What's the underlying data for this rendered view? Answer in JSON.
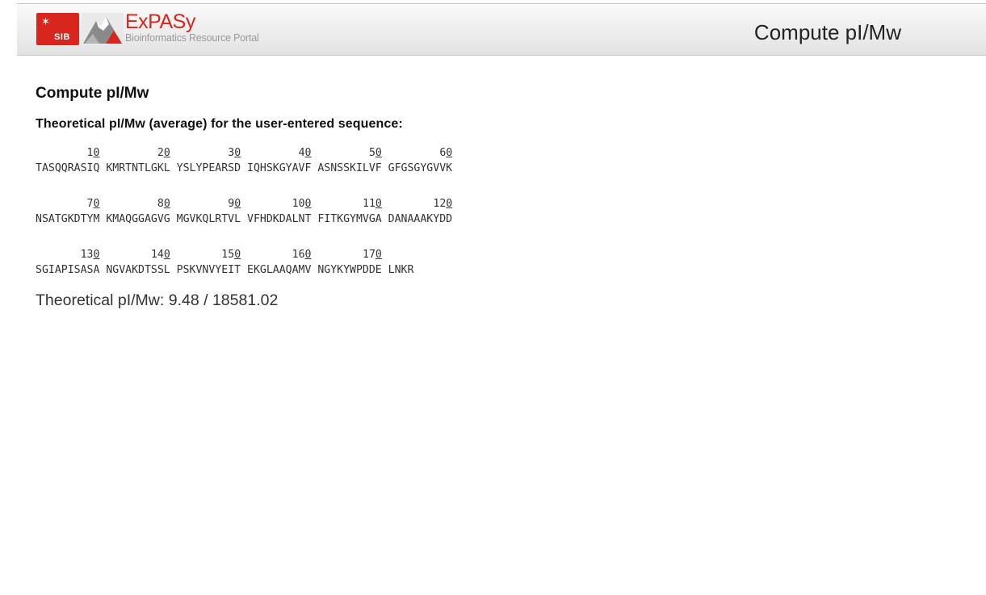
{
  "header": {
    "logo_sib": "SIB",
    "logo_name": "ExPASy",
    "logo_tagline": "Bioinformatics Resource Portal",
    "title": "Compute pI/Mw",
    "brand_color": "#d8261f"
  },
  "main": {
    "title": "Compute pI/Mw",
    "subtitle": "Theoretical pI/Mw (average) for the user-entered sequence:",
    "sequence_blocks": [
      {
        "ruler": "        10         20         30         40         50         60",
        "line": "TASQQRASIQ KMRTNTLGKL YSLYPEARSD IQHSKGYAVF ASNSSKILVF GFGSGYGVVK"
      },
      {
        "ruler": "        70         80         90        100        110        120",
        "line": "NSATGKDTYM KMAQGGAGVG MGVKQLRTVL VFHDKDALNT FITKGYMVGA DANAAAKYDD"
      },
      {
        "ruler": "       130        140        150        160        170",
        "line": "SGIAPISASA NGVAKDTSSL PSKVNVYEIT EKGLAAQAMV NGYKYWPDDE LNKR"
      }
    ],
    "result_label": "Theoretical pI/Mw:",
    "pI": "9.48",
    "mw": "18581.02"
  }
}
